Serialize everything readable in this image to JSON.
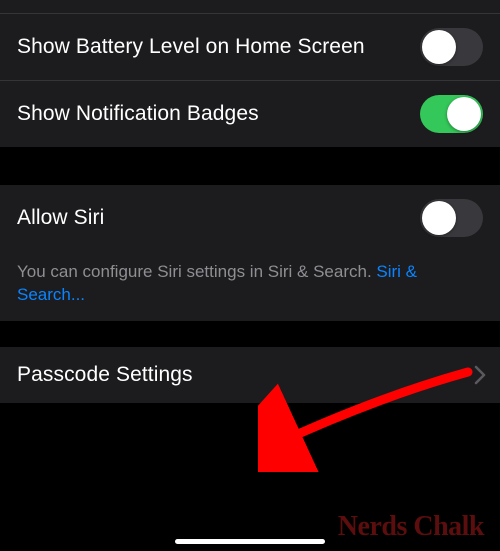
{
  "group1": {
    "battery": {
      "label": "Show Battery Level on Home Screen",
      "state": "off"
    },
    "badges": {
      "label": "Show Notification Badges",
      "state": "on"
    }
  },
  "group2": {
    "siri": {
      "label": "Allow Siri",
      "state": "off"
    },
    "footer_prefix": "You can configure Siri settings in Siri & Search. ",
    "footer_link": "Siri & Search..."
  },
  "group3": {
    "passcode": {
      "label": "Passcode Settings"
    }
  },
  "watermark": "Nerds Chalk"
}
